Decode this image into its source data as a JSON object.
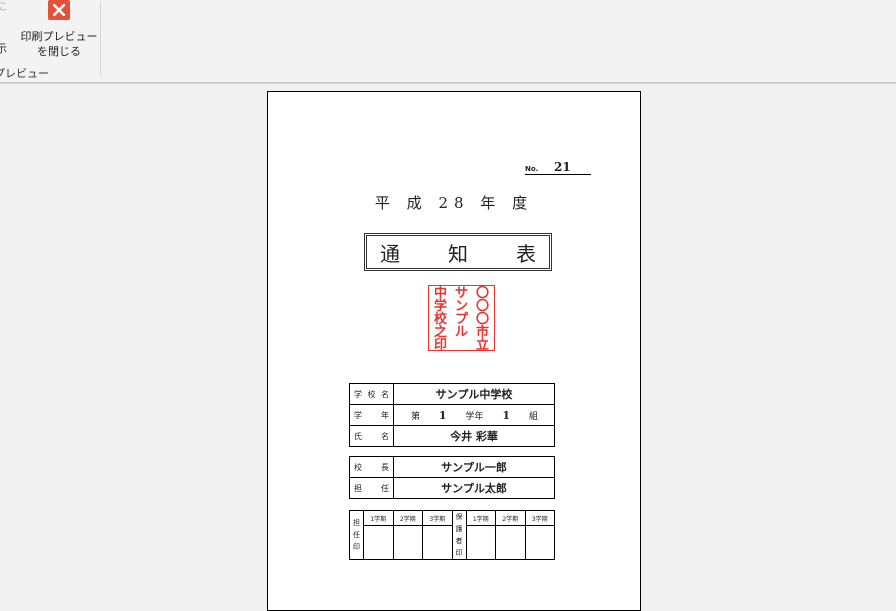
{
  "ribbon": {
    "partial_top_text": "こ",
    "partial_show_label": "示",
    "group_label": "プレビュー",
    "close_button": {
      "line1": "印刷プレビュー",
      "line2": "を閉じる",
      "icon": "close-x-icon"
    },
    "accent_color": "#e2523a"
  },
  "document": {
    "number_label": "No.",
    "number_value": "21",
    "era_title": "平 成 28 年 度",
    "report_title": [
      "通",
      "知",
      "表"
    ],
    "stamp": {
      "color": "#e8332e",
      "columns": [
        [
          "〇",
          "〇",
          "〇",
          "市",
          "立"
        ],
        [
          "サ",
          "ン",
          "プ",
          "ル"
        ],
        [
          "中",
          "学",
          "校",
          "之",
          "印"
        ]
      ]
    },
    "info": {
      "school_label": "学 校 名",
      "school_value": "サンプル中学校",
      "grade_label": "学 年",
      "grade_prefix": "第",
      "grade_value": "1",
      "grade_unit": "学年",
      "class_value": "1",
      "class_unit": "組",
      "name_label": "氏 名",
      "name_value": "今井 彩華"
    },
    "staff": {
      "principal_label": "校 長",
      "principal_value": "サンプル一郎",
      "teacher_label": "担 任",
      "teacher_value": "サンプル太郎"
    },
    "seals": {
      "teacher_label": [
        "担",
        "任",
        "印"
      ],
      "guardian_label": [
        "保",
        "護",
        "者",
        "印"
      ],
      "terms": [
        "1学期",
        "2学期",
        "3学期"
      ]
    }
  }
}
